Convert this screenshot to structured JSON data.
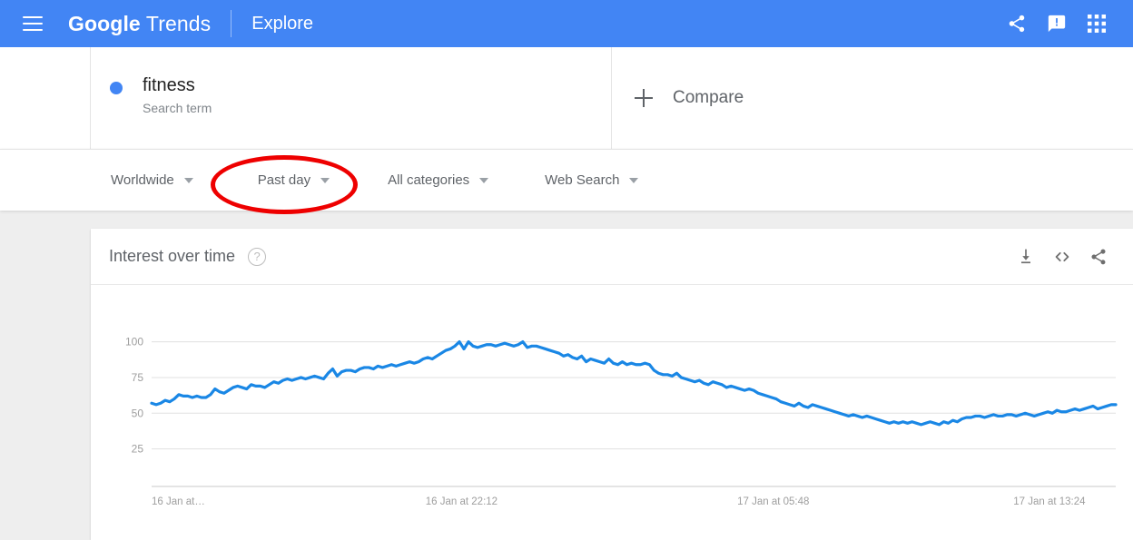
{
  "header": {
    "menu_icon": "hamburger-icon",
    "brand_google": "Google",
    "brand_trends": " Trends",
    "explore": "Explore",
    "icons": [
      "share-icon",
      "feedback-icon",
      "apps-grid-icon"
    ]
  },
  "terms": {
    "term_label": "fitness",
    "term_type": "Search term",
    "term_color": "#4285f4",
    "compare_label": "Compare"
  },
  "filters": [
    {
      "label": "Worldwide",
      "name": "location-filter"
    },
    {
      "label": "Past day",
      "name": "time-range-filter"
    },
    {
      "label": "All categories",
      "name": "category-filter"
    },
    {
      "label": "Web Search",
      "name": "search-type-filter"
    }
  ],
  "annotation": {
    "shape": "ellipse",
    "color": "#ee0000",
    "targets": "time-range-filter"
  },
  "card": {
    "title": "Interest over time",
    "help_icon": "help-circle-icon",
    "actions": [
      "download-icon",
      "embed-code-icon",
      "share-icon"
    ]
  },
  "chart_data": {
    "type": "line",
    "title": "Interest over time",
    "xlabel": "",
    "ylabel": "",
    "ylim": [
      0,
      108
    ],
    "yticks": [
      100,
      75,
      50,
      25
    ],
    "grid": true,
    "legend": false,
    "line_color": "#1a87e5",
    "xticks": [
      "16 Jan at…",
      "16 Jan at 22:12",
      "17 Jan at 05:48",
      "17 Jan at 13:24"
    ],
    "xtick_positions": [
      0,
      0.3215,
      0.6448,
      0.9685
    ],
    "series": [
      {
        "name": "fitness",
        "values": [
          57,
          56,
          57,
          59,
          58,
          60,
          63,
          62,
          62,
          61,
          62,
          61,
          61,
          63,
          67,
          65,
          64,
          66,
          68,
          69,
          68,
          67,
          70,
          69,
          69,
          68,
          70,
          72,
          71,
          73,
          74,
          73,
          74,
          75,
          74,
          75,
          76,
          75,
          74,
          78,
          81,
          76,
          79,
          80,
          80,
          79,
          81,
          82,
          82,
          81,
          83,
          82,
          83,
          84,
          83,
          84,
          85,
          86,
          85,
          86,
          88,
          89,
          88,
          90,
          92,
          94,
          95,
          97,
          100,
          95,
          100,
          97,
          96,
          97,
          98,
          98,
          97,
          98,
          99,
          98,
          97,
          98,
          100,
          96,
          97,
          97,
          96,
          95,
          94,
          93,
          92,
          90,
          91,
          89,
          88,
          90,
          86,
          88,
          87,
          86,
          85,
          88,
          85,
          84,
          86,
          84,
          85,
          84,
          84,
          85,
          84,
          80,
          78,
          77,
          77,
          76,
          78,
          75,
          74,
          73,
          72,
          73,
          71,
          70,
          72,
          71,
          70,
          68,
          69,
          68,
          67,
          66,
          67,
          66,
          64,
          63,
          62,
          61,
          60,
          58,
          57,
          56,
          55,
          57,
          55,
          54,
          56,
          55,
          54,
          53,
          52,
          51,
          50,
          49,
          48,
          49,
          48,
          47,
          48,
          47,
          46,
          45,
          44,
          43,
          44,
          43,
          44,
          43,
          44,
          43,
          42,
          43,
          44,
          43,
          42,
          44,
          43,
          45,
          44,
          46,
          47,
          47,
          48,
          48,
          47,
          48,
          49,
          48,
          48,
          49,
          49,
          48,
          49,
          50,
          49,
          48,
          49,
          50,
          51,
          50,
          52,
          51,
          51,
          52,
          53,
          52,
          53,
          54,
          55,
          53,
          54,
          55,
          56,
          56
        ]
      }
    ]
  }
}
